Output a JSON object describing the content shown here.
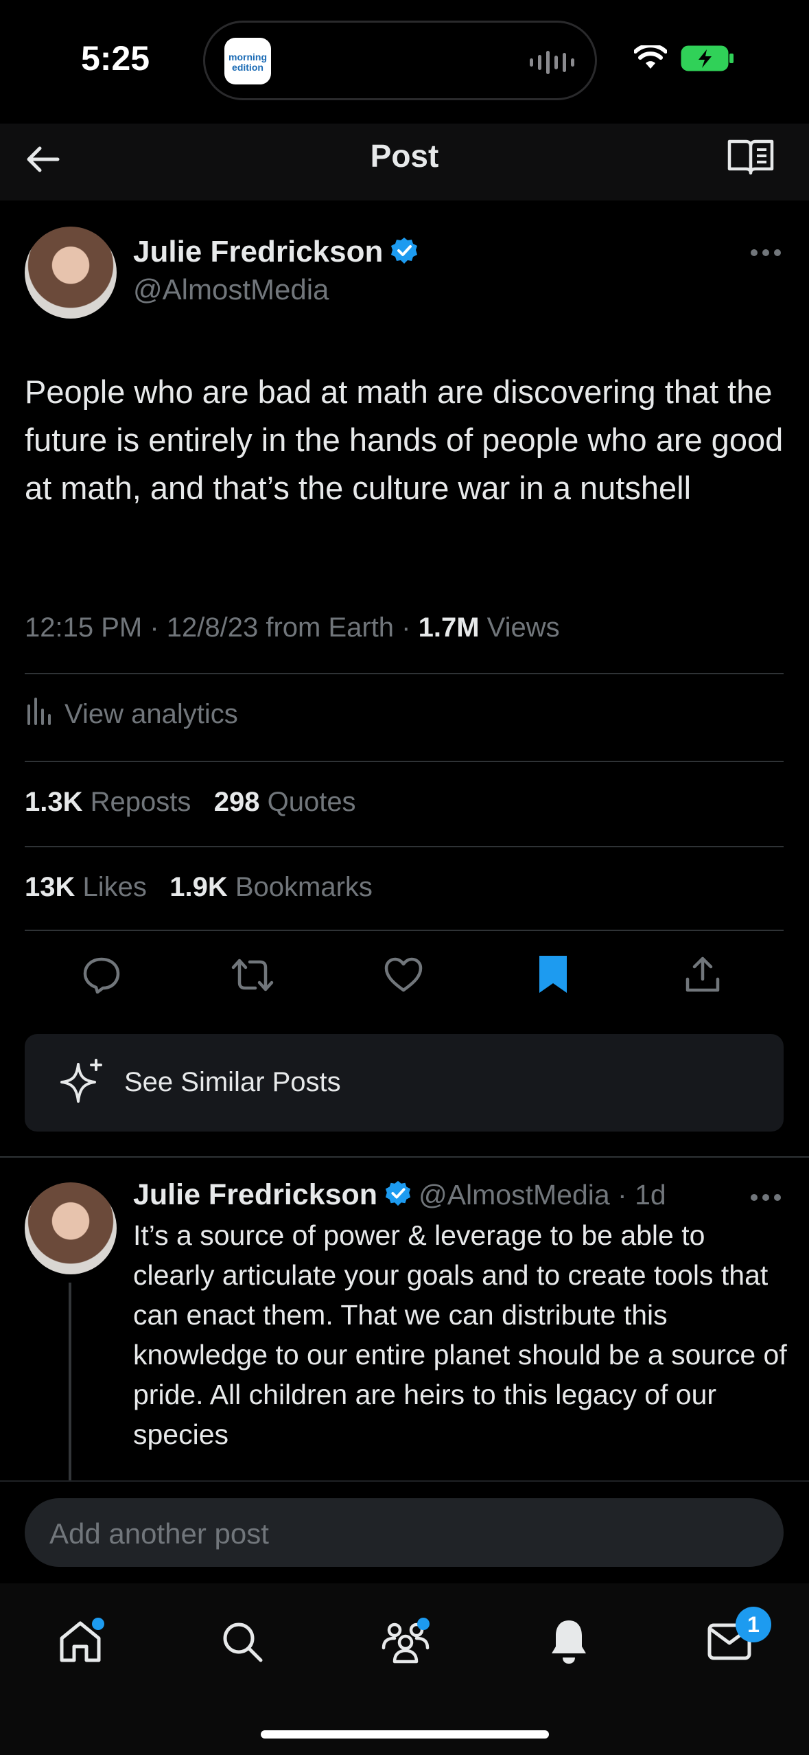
{
  "status": {
    "time": "5:25",
    "island_app": "morning edition"
  },
  "header": {
    "title": "Post"
  },
  "post": {
    "author_name": "Julie Fredrickson",
    "handle": "@AlmostMedia",
    "text": "People who are bad at math are discovering that the future is entirely in the hands of people who are good at math, and that’s the culture war in a nutshell",
    "meta_prefix": "12:15 PM · 12/8/23 from Earth · ",
    "views_count": "1.7M",
    "views_label": " Views",
    "analytics_label": "View analytics",
    "reposts_count": "1.3K",
    "reposts_label": "Reposts",
    "quotes_count": "298",
    "quotes_label": "Quotes",
    "likes_count": "13K",
    "likes_label": "Likes",
    "bookmarks_count": "1.9K",
    "bookmarks_label": "Bookmarks",
    "bookmarked": true,
    "accent_color": "#1d9bf0"
  },
  "similar": {
    "label": "See Similar Posts"
  },
  "reply": {
    "author_name": "Julie Fredrickson",
    "handle_time": "@AlmostMedia · 1d",
    "text": "It’s a source of power & leverage to be able to clearly articulate your goals and to create tools that can enact them. That we can distribute this knowledge to our entire planet should be a source of pride. All children are heirs to this legacy of our species"
  },
  "composer": {
    "placeholder": "Add another post"
  },
  "tabbar": {
    "messages_badge": "1"
  }
}
